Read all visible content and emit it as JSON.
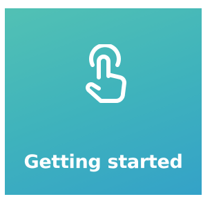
{
  "tile": {
    "label": "Getting started",
    "icon": "tap-hand-icon",
    "gradient_start": "#52c1b4",
    "gradient_end": "#34a2c8",
    "text_color": "#ffffff"
  }
}
